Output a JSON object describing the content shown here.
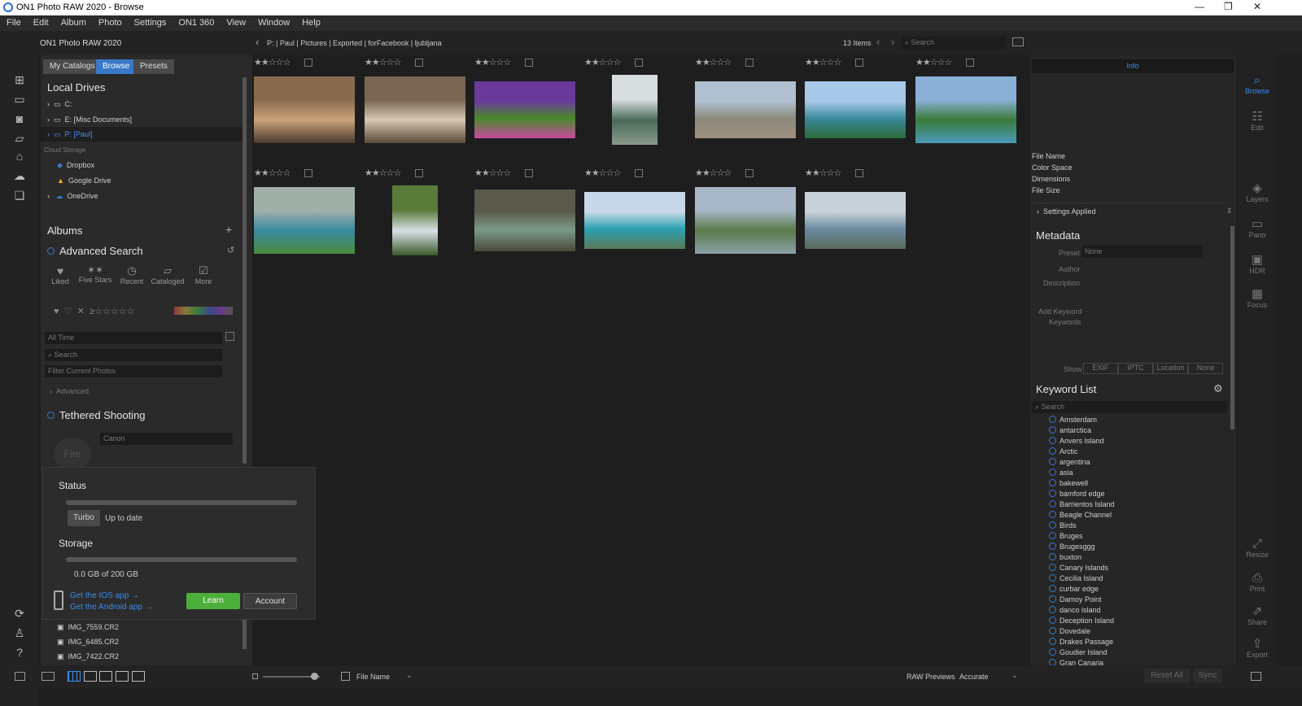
{
  "window": {
    "title": "ON1 Photo RAW 2020 - Browse"
  },
  "menu": [
    "File",
    "Edit",
    "Album",
    "Photo",
    "Settings",
    "ON1 360",
    "View",
    "Window",
    "Help"
  ],
  "header": {
    "app": "ON1 Photo RAW 2020",
    "breadcrumb": "P:  |  Paul  |  Pictures  |  Exported  |  forFacebook  |  ljubljana",
    "count": "13 Items",
    "search_placeholder": "Search"
  },
  "tabs": [
    "My Catalogs",
    "Browse",
    "Presets"
  ],
  "local": {
    "heading": "Local Drives",
    "drives": [
      "C:",
      "E: [Misc Documents]",
      "P: [Paul]"
    ],
    "cloud_heading": "Cloud Storage",
    "cloud": [
      "Dropbox",
      "Google Drive",
      "OneDrive"
    ]
  },
  "albums": {
    "heading": "Albums",
    "adv": "Advanced Search",
    "quick": [
      "Liked",
      "Five Stars",
      "Recent",
      "Cataloged",
      "More"
    ],
    "time": "All Time",
    "search": "Search",
    "filter": "Filter Current Photos",
    "advanced": "Advanced"
  },
  "tethered": {
    "heading": "Tethered Shooting",
    "fire": "Fire",
    "camera": "Canon"
  },
  "popup": {
    "status": "Status",
    "turbo": "Turbo",
    "uptodate": "Up to date",
    "storage": "Storage",
    "storage_value": "0.0 GB of 200 GB",
    "ios": "Get the IOS app →",
    "android": "Get the Android app →",
    "learn": "Learn",
    "account": "Account"
  },
  "files": [
    "IMG_7559.CR2",
    "IMG_6485.CR2",
    "IMG_7422.CR2"
  ],
  "thumbs": [
    {
      "stars": "★★☆☆☆",
      "colors": [
        "#8a6a4e",
        "#c9a37a",
        "#4a3a2e"
      ]
    },
    {
      "stars": "★★☆☆☆",
      "colors": [
        "#7a6650",
        "#d8c8b0",
        "#5a4a38"
      ]
    },
    {
      "stars": "★★☆☆☆",
      "colors": [
        "#6a3a9a",
        "#4a8a2a",
        "#c84aa0"
      ]
    },
    {
      "stars": "★★☆☆☆",
      "colors": [
        "#d8dde0",
        "#4a6a5a",
        "#8a9a8a"
      ]
    },
    {
      "stars": "★★☆☆☆",
      "colors": [
        "#b0c0d0",
        "#8a8a7a",
        "#a09080"
      ]
    },
    {
      "stars": "★★☆☆☆",
      "colors": [
        "#a8c8e8",
        "#3a8a9a",
        "#2a6a3a"
      ]
    },
    {
      "stars": "★★☆☆☆",
      "colors": [
        "#8ab0d8",
        "#3a7a3a",
        "#4a9aba"
      ]
    },
    {
      "stars": "★★☆☆☆",
      "colors": [
        "#a0b0a8",
        "#3a8aa0",
        "#4a8a3a"
      ]
    },
    {
      "stars": "★★☆☆☆",
      "colors": [
        "#5a7a3a",
        "#d8e0e8",
        "#3a5a2a"
      ]
    },
    {
      "stars": "★★☆☆☆",
      "colors": [
        "#5a5a4a",
        "#7a9a8a",
        "#4a4a3a"
      ]
    },
    {
      "stars": "★★☆☆☆",
      "colors": [
        "#c8d8e8",
        "#2aa0b0",
        "#5a7a5a"
      ]
    },
    {
      "stars": "★★☆☆☆",
      "colors": [
        "#a8b8c8",
        "#5a7a4a",
        "#8aa0a8"
      ]
    },
    {
      "stars": "★★☆☆☆",
      "colors": [
        "#c8d0d8",
        "#6a8aa0",
        "#5a6a5a"
      ]
    }
  ],
  "info": {
    "tab": "Info",
    "fields": [
      "File Name",
      "Color Space",
      "Dimensions",
      "File Size"
    ],
    "settings": "Settings Applied",
    "metadata": "Metadata",
    "preset_label": "Preset",
    "preset_value": "None",
    "author": "Author",
    "description": "Description",
    "add_keyword": "Add Keyword",
    "keywords": "Keywords",
    "show": "Show",
    "show_opts": [
      "EXIF",
      "IPTC",
      "Location",
      "None"
    ]
  },
  "keywords": {
    "heading": "Keyword List",
    "search": "Search",
    "items": [
      "Amsterdam",
      "antarctica",
      "Anvers Island",
      "Arctic",
      "argentina",
      "asia",
      "bakewell",
      "bamford edge",
      "Barrientos Island",
      "Beagle Channel",
      "Birds",
      "Bruges",
      "Brugesggg",
      "buxton",
      "Canary Islands",
      "Cecilia Island",
      "curbar edge",
      "Damoy Point",
      "danco island",
      "Deception Island",
      "Dovedale",
      "Drakes Passage",
      "Goudier Island",
      "Gran Canaria"
    ]
  },
  "righttools": [
    "Browse",
    "Edit",
    "Layers",
    "Pano",
    "HDR",
    "Focus",
    "Resize",
    "Print",
    "Share",
    "Export"
  ],
  "bottom": {
    "sort": "File Name",
    "raw_label": "RAW Previews",
    "raw_value": "Accurate",
    "reset": "Reset All",
    "sync": "Sync"
  },
  "accent": "#3a78c8"
}
